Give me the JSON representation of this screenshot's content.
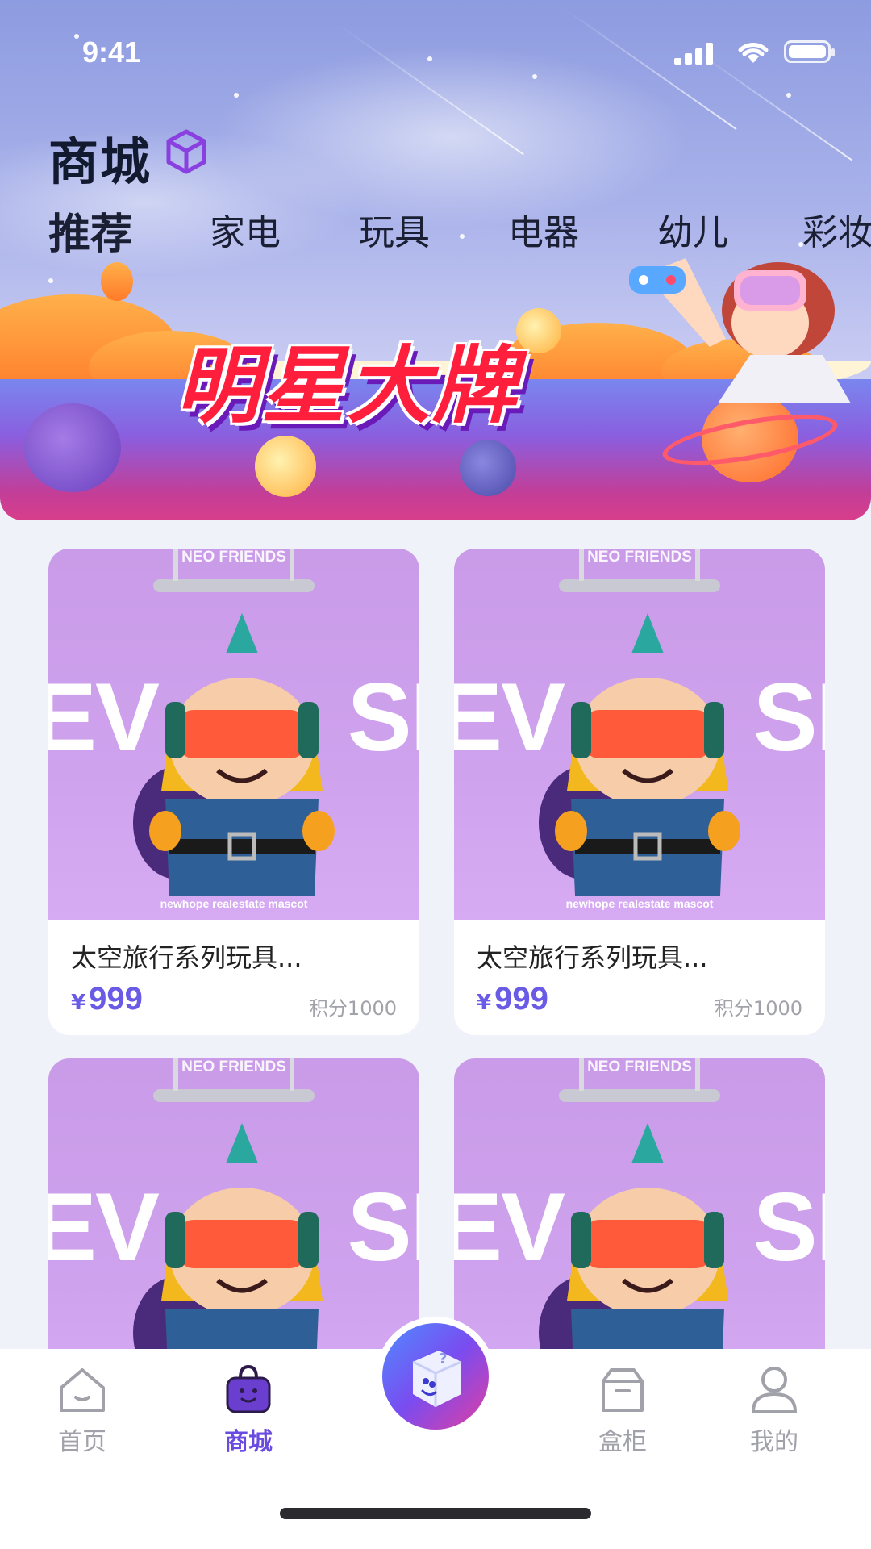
{
  "status_bar": {
    "time": "9:41"
  },
  "header": {
    "title": "商城",
    "icon": "cube-icon"
  },
  "tabs": [
    {
      "label": "推荐",
      "active": true
    },
    {
      "label": "家电",
      "active": false
    },
    {
      "label": "玩具",
      "active": false
    },
    {
      "label": "电器",
      "active": false
    },
    {
      "label": "幼儿",
      "active": false
    },
    {
      "label": "彩妆",
      "active": false
    }
  ],
  "banner": {
    "text": "明星大牌"
  },
  "products": [
    {
      "name": "太空旅行系列玩具...",
      "currency": "¥",
      "price": "999",
      "points": "积分1000",
      "image_brand": "NEO FRIENDS",
      "image_text_left": "EV",
      "image_text_right": "SI",
      "image_caption": "newhope realestate mascot"
    },
    {
      "name": "太空旅行系列玩具...",
      "currency": "¥",
      "price": "999",
      "points": "积分1000",
      "image_brand": "NEO FRIENDS",
      "image_text_left": "EV",
      "image_text_right": "SI",
      "image_caption": "newhope realestate mascot"
    },
    {
      "image_brand": "NEO FRIENDS",
      "image_text_left": "EV",
      "image_text_right": "SI"
    },
    {
      "image_brand": "NEO FRIENDS",
      "image_text_left": "EV",
      "image_text_right": "SI"
    }
  ],
  "tabbar": {
    "items": [
      {
        "label": "首页",
        "icon": "home-icon",
        "active": false
      },
      {
        "label": "商城",
        "icon": "shopping-bag-icon",
        "active": true
      },
      {
        "label": "",
        "icon": "mystery-box-icon",
        "active": false
      },
      {
        "label": "盒柜",
        "icon": "box-cabinet-icon",
        "active": false
      },
      {
        "label": "我的",
        "icon": "user-icon",
        "active": false
      }
    ]
  },
  "colors": {
    "accent": "#6a4be0",
    "price": "#6a5be6",
    "banner_text": "#ff1f3d",
    "product_bg": "#cfa2ee"
  }
}
